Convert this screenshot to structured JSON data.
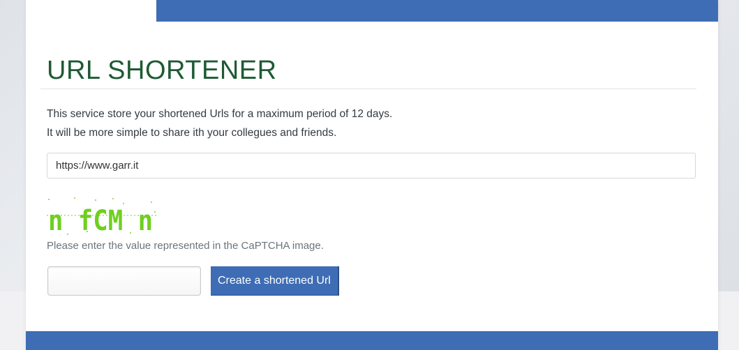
{
  "page": {
    "title": "URL SHORTENER",
    "description_line1": "This service store your shortened Urls for a maximum period of 12 days.",
    "description_line2": "It will be more simple to share ith your collegues and friends."
  },
  "form": {
    "url_value": "https://www.garr.it",
    "captcha_text": "n fCM n",
    "captcha_hint": "Please enter the value represented in the CaPTCHA image.",
    "captcha_value": "",
    "submit_label": "Create a shortened Url"
  },
  "colors": {
    "brand_blue": "#3e6db5",
    "title_green": "#1e5a34",
    "captcha_green": "#6fcf1f"
  }
}
